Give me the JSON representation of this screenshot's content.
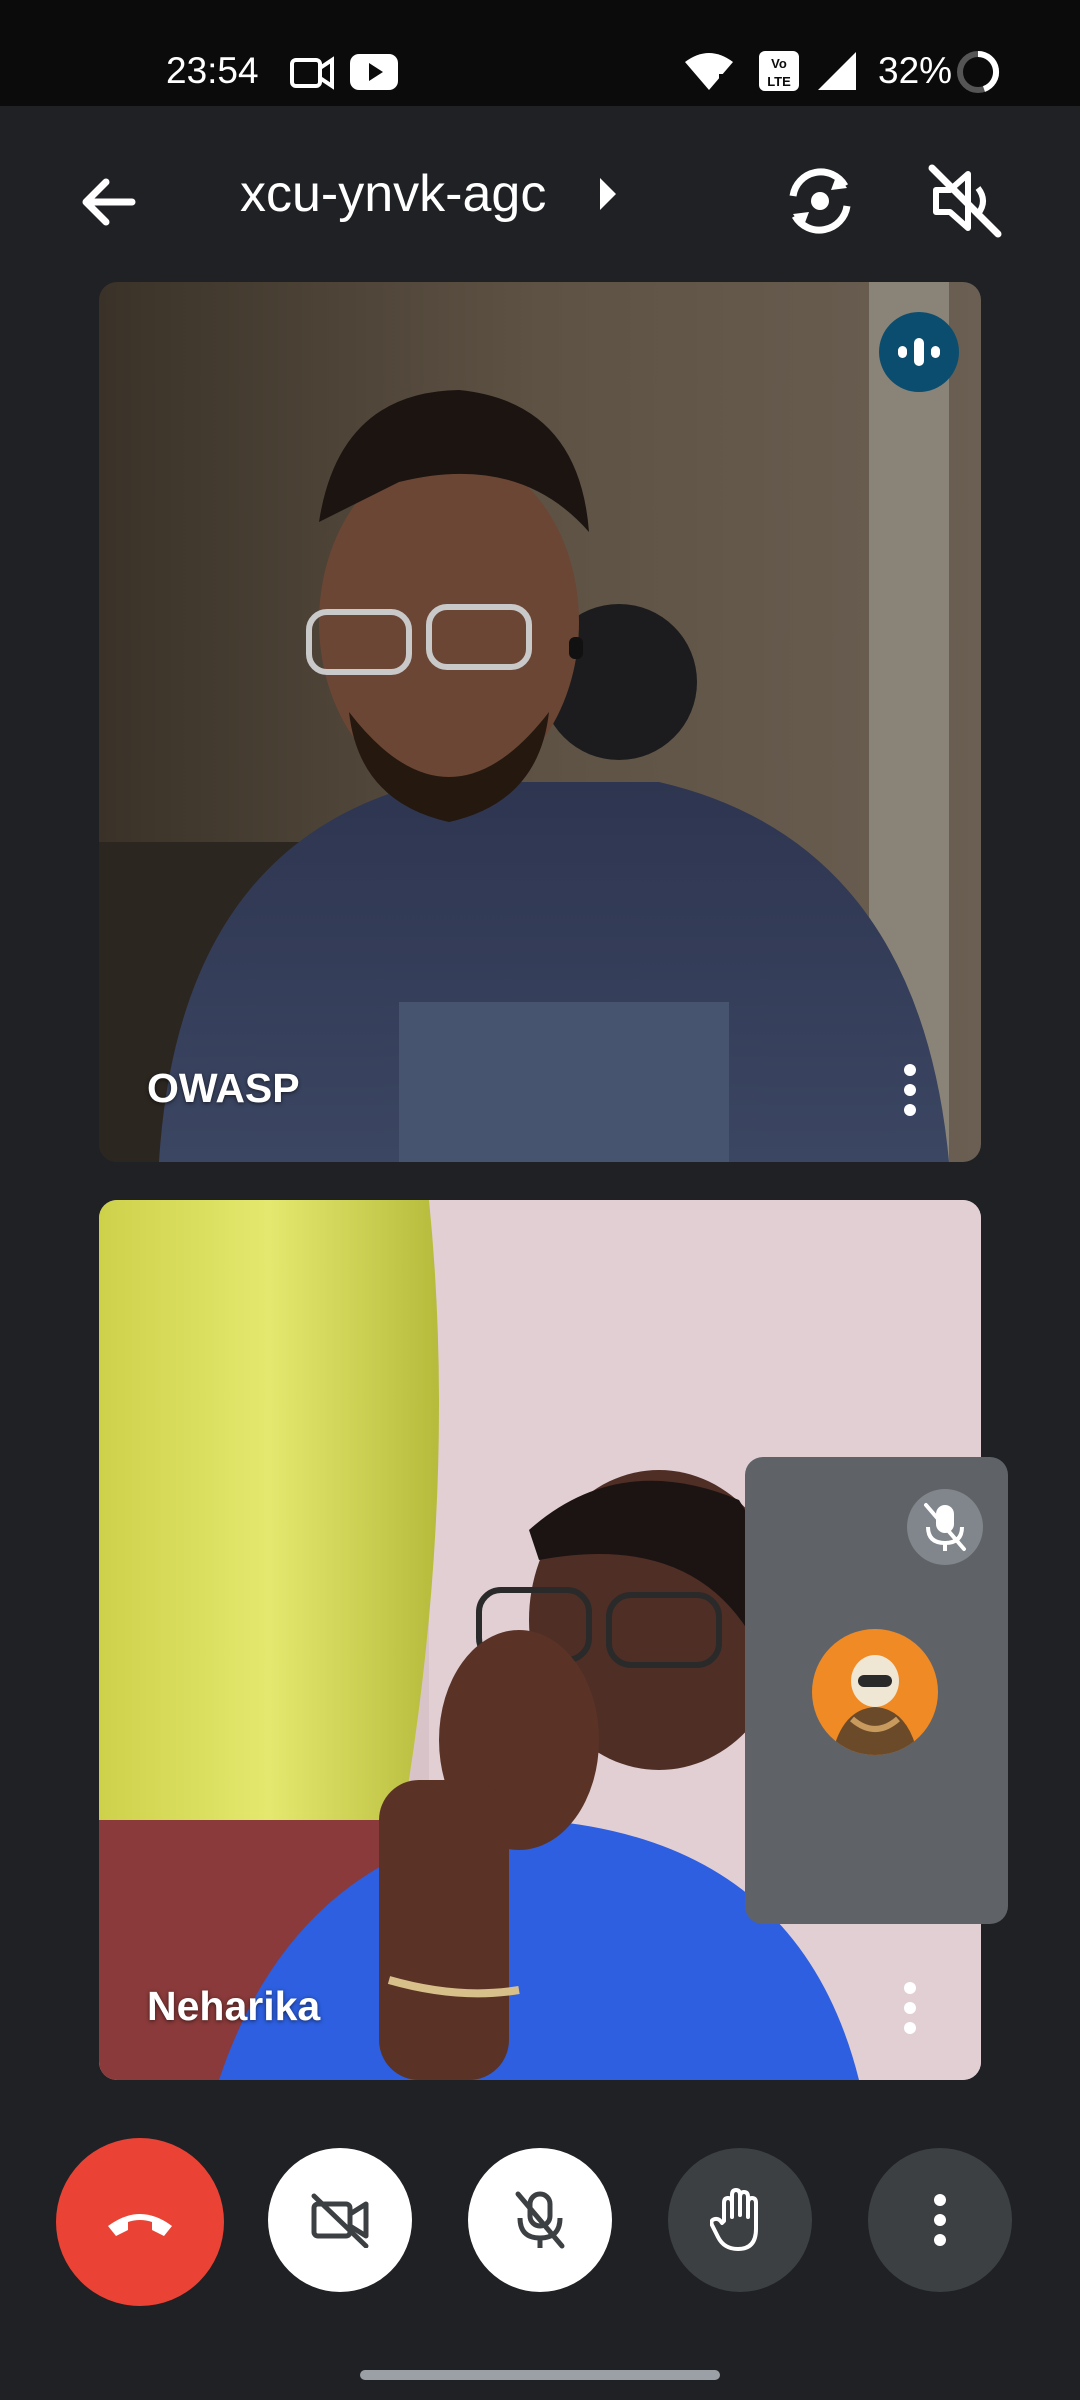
{
  "status_bar": {
    "time": "23:54",
    "battery": "32%",
    "icons": [
      "video-camera-icon",
      "youtube-icon",
      "wifi-icon",
      "volte-icon",
      "signal-icon",
      "battery-ring-icon"
    ]
  },
  "top_bar": {
    "meeting_code": "xcu-ynvk-agc",
    "icons": [
      "back-arrow-icon",
      "caret-right-icon",
      "flip-camera-icon",
      "speaker-off-icon"
    ]
  },
  "participants": [
    {
      "name": "OWASP",
      "speaking": true
    },
    {
      "name": "Neharika",
      "speaking": false
    }
  ],
  "self_view": {
    "muted": true,
    "avatar": "astronaut-avatar"
  },
  "controls": [
    {
      "id": "end-call",
      "icon": "phone-hangup-icon",
      "color": "#ea4335"
    },
    {
      "id": "camera",
      "icon": "camera-off-icon",
      "color": "#ffffff"
    },
    {
      "id": "microphone",
      "icon": "mic-off-icon",
      "color": "#ffffff"
    },
    {
      "id": "raise-hand",
      "icon": "hand-icon",
      "color": "#3c4043"
    },
    {
      "id": "more",
      "icon": "more-vertical-icon",
      "color": "#3c4043"
    }
  ],
  "colors": {
    "background": "#202124",
    "accent_speaking": "#0b4d6e",
    "end_call": "#ea4335"
  }
}
